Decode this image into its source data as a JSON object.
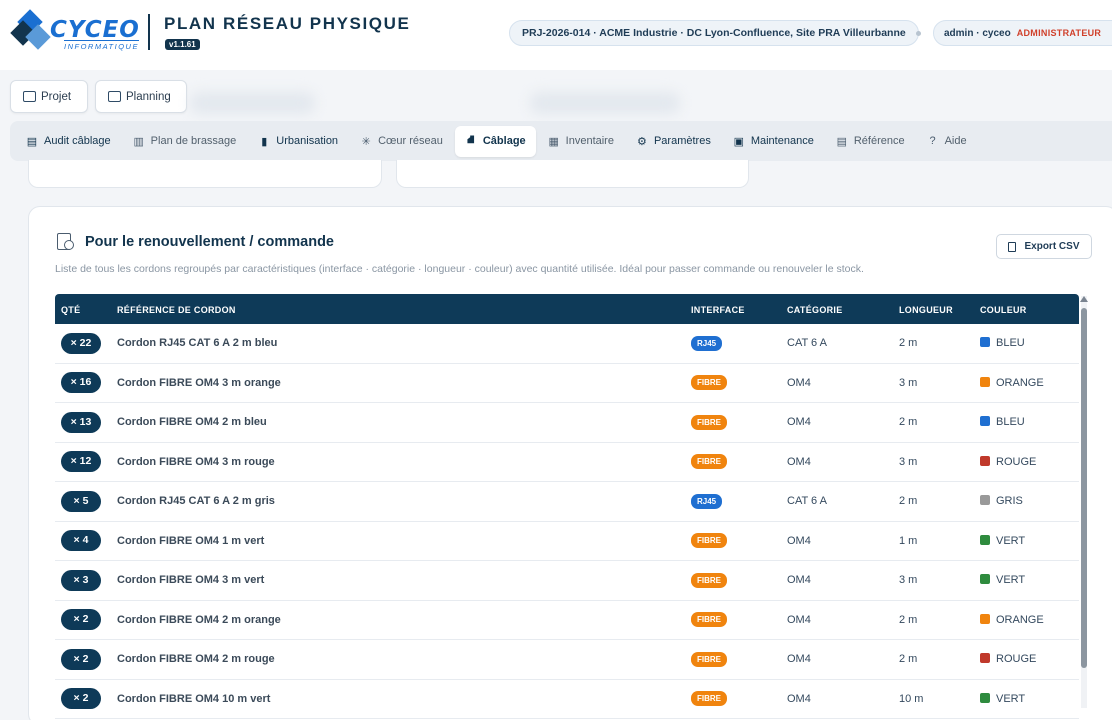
{
  "brand": {
    "logo_text": "CYCEO",
    "logo_sub": "INFORMATIQUE",
    "app_title": "PLAN RÉSEAU PHYSIQUE",
    "version": "v1.1.61"
  },
  "header": {
    "project": "PRJ-2026-014 · ACME Industrie · DC Lyon-Confluence, Site PRA Villeurbanne",
    "user": "admin · cyceo",
    "role": "ADMINISTRATEUR"
  },
  "top_buttons": [
    "Projet",
    "Planning"
  ],
  "tabs": [
    {
      "label": "Audit câblage",
      "icon": "audit-icon",
      "glyph": "▤"
    },
    {
      "label": "Plan de brassage",
      "icon": "patch-plan-icon",
      "glyph": "▥"
    },
    {
      "label": "Urbanisation",
      "icon": "building-icon",
      "glyph": "▮"
    },
    {
      "label": "Cœur réseau",
      "icon": "core-network-icon",
      "glyph": "✳"
    },
    {
      "label": "Câblage",
      "icon": "cable-icon",
      "glyph": "⛘"
    },
    {
      "label": "Inventaire",
      "icon": "inventory-icon",
      "glyph": "▦"
    },
    {
      "label": "Paramètres",
      "icon": "gear-icon",
      "glyph": "⚙"
    },
    {
      "label": "Maintenance",
      "icon": "maintenance-icon",
      "glyph": "▣"
    },
    {
      "label": "Référence",
      "icon": "reference-icon",
      "glyph": "▤"
    },
    {
      "label": "Aide",
      "icon": "help-icon",
      "glyph": "?"
    }
  ],
  "active_tab": "Câblage",
  "section": {
    "title": "Pour le renouvellement / commande",
    "subtitle": "Liste de tous les cordons regroupés par caractéristiques (interface · catégorie · longueur · couleur) avec quantité utilisée. Idéal pour passer commande ou renouveler le stock.",
    "export_label": "Export CSV"
  },
  "table": {
    "headers": {
      "qty": "QTÉ",
      "ref": "RÉFÉRENCE DE CORDON",
      "interface": "INTERFACE",
      "category": "CATÉGORIE",
      "length": "LONGUEUR",
      "color": "COULEUR"
    },
    "rows": [
      {
        "qty": "× 22",
        "ref": "Cordon RJ45 CAT 6 A 2 m bleu",
        "interface": "RJ45",
        "category": "CAT 6 A",
        "length": "2 m",
        "color": "BLEU",
        "swatch": "#1f6fd1"
      },
      {
        "qty": "× 16",
        "ref": "Cordon FIBRE OM4 3 m orange",
        "interface": "FIBRE",
        "category": "OM4",
        "length": "3 m",
        "color": "ORANGE",
        "swatch": "#f0840e"
      },
      {
        "qty": "× 13",
        "ref": "Cordon FIBRE OM4 2 m bleu",
        "interface": "FIBRE",
        "category": "OM4",
        "length": "2 m",
        "color": "BLEU",
        "swatch": "#1f6fd1"
      },
      {
        "qty": "× 12",
        "ref": "Cordon FIBRE OM4 3 m rouge",
        "interface": "FIBRE",
        "category": "OM4",
        "length": "3 m",
        "color": "ROUGE",
        "swatch": "#c0392b"
      },
      {
        "qty": "× 5",
        "ref": "Cordon RJ45 CAT 6 A 2 m gris",
        "interface": "RJ45",
        "category": "CAT 6 A",
        "length": "2 m",
        "color": "GRIS",
        "swatch": "#999999"
      },
      {
        "qty": "× 4",
        "ref": "Cordon FIBRE OM4 1 m vert",
        "interface": "FIBRE",
        "category": "OM4",
        "length": "1 m",
        "color": "VERT",
        "swatch": "#2e8b3e"
      },
      {
        "qty": "× 3",
        "ref": "Cordon FIBRE OM4 3 m vert",
        "interface": "FIBRE",
        "category": "OM4",
        "length": "3 m",
        "color": "VERT",
        "swatch": "#2e8b3e"
      },
      {
        "qty": "× 2",
        "ref": "Cordon FIBRE OM4 2 m orange",
        "interface": "FIBRE",
        "category": "OM4",
        "length": "2 m",
        "color": "ORANGE",
        "swatch": "#f0840e"
      },
      {
        "qty": "× 2",
        "ref": "Cordon FIBRE OM4 2 m rouge",
        "interface": "FIBRE",
        "category": "OM4",
        "length": "2 m",
        "color": "ROUGE",
        "swatch": "#c0392b"
      },
      {
        "qty": "× 2",
        "ref": "Cordon FIBRE OM4 10 m vert",
        "interface": "FIBRE",
        "category": "OM4",
        "length": "10 m",
        "color": "VERT",
        "swatch": "#2e8b3e"
      }
    ]
  }
}
